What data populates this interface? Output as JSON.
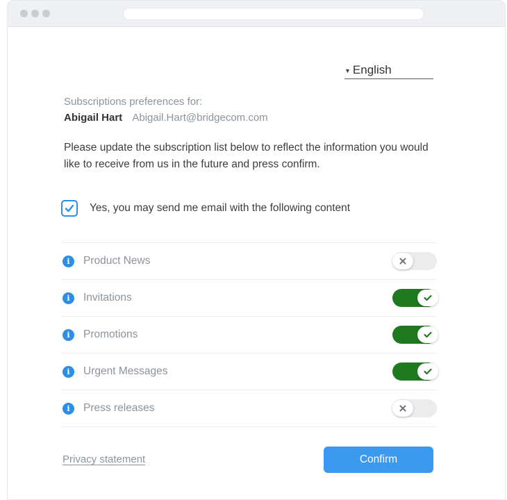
{
  "language": {
    "selected": "English"
  },
  "header": {
    "subscriptions_label": "Subscriptions preferences for:",
    "user_name": "Abigail Hart",
    "user_email": "Abigail.Hart@bridgecom.com"
  },
  "intro_text": "Please update the subscription list below to reflect the information you would like to receive from us in the future and press confirm.",
  "consent": {
    "label": "Yes, you may send me email with the following content",
    "checked": true
  },
  "subscriptions": [
    {
      "label": "Product News",
      "enabled": false
    },
    {
      "label": "Invitations",
      "enabled": true
    },
    {
      "label": "Promotions",
      "enabled": true
    },
    {
      "label": "Urgent Messages",
      "enabled": true
    },
    {
      "label": "Press releases",
      "enabled": false
    }
  ],
  "footer": {
    "privacy_label": "Privacy statement",
    "confirm_label": "Confirm"
  },
  "colors": {
    "accent": "#2e8ee6",
    "button": "#3b9af0",
    "toggle_on": "#1f7a1f",
    "toggle_off": "#ececec",
    "check_green": "#1f7a1f"
  }
}
